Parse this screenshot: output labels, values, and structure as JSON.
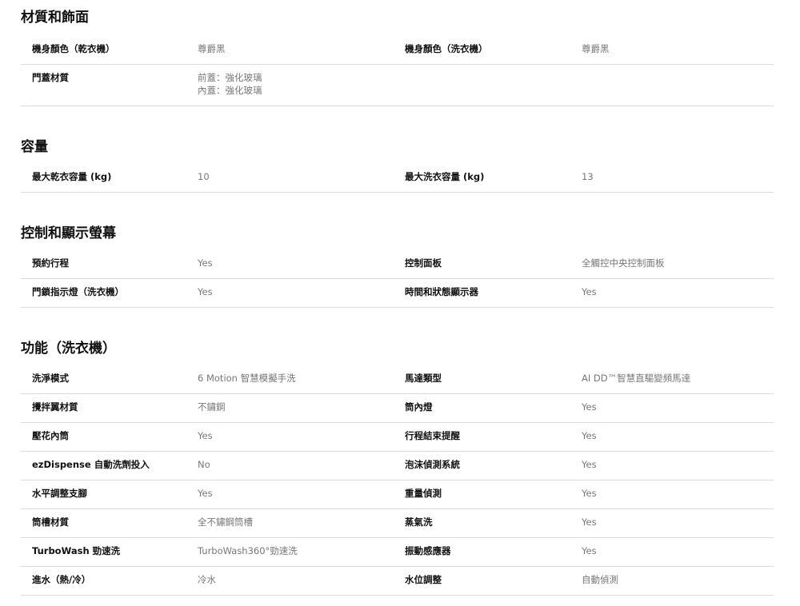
{
  "sections": [
    {
      "title": "材質和飾面",
      "rows": [
        {
          "label1": "機身顏色（乾衣機）",
          "value1": "尊爵黑",
          "label2": "機身顏色（洗衣機）",
          "value2": "尊爵黑"
        },
        {
          "label1": "門蓋材質",
          "value1_lines": [
            "前蓋：強化玻璃",
            "內蓋：強化玻璃"
          ],
          "label2": "",
          "value2": ""
        }
      ]
    },
    {
      "title": "容量",
      "rows": [
        {
          "label1": "最大乾衣容量 (kg)",
          "value1": "10",
          "label2": "最大洗衣容量 (kg)",
          "value2": "13"
        }
      ]
    },
    {
      "title": "控制和顯示螢幕",
      "rows": [
        {
          "label1": "預約行程",
          "value1": "Yes",
          "label2": "控制面板",
          "value2": "全觸控中央控制面板"
        },
        {
          "label1": "門鎖指示燈（洗衣機）",
          "value1": "Yes",
          "label2": "時間和狀態顯示器",
          "value2": "Yes"
        }
      ]
    },
    {
      "title": "功能（洗衣機）",
      "rows": [
        {
          "label1": "洗淨模式",
          "value1": "6 Motion 智慧模擬手洗",
          "label2": "馬達類型",
          "value2": "AI DD™智慧直驅變頻馬達"
        },
        {
          "label1": "攪拌翼材質",
          "value1": "不鏽鋼",
          "label2": "筒內燈",
          "value2": "Yes"
        },
        {
          "label1": "壓花內筒",
          "value1": "Yes",
          "label2": "行程結束提醒",
          "value2": "Yes"
        },
        {
          "label1": "ezDispense 自動洗劑投入",
          "value1": "No",
          "label2": "泡沫偵測系統",
          "value2": "Yes"
        },
        {
          "label1": "水平調整支腳",
          "value1": "Yes",
          "label2": "重量偵測",
          "value2": "Yes"
        },
        {
          "label1": "筒槽材質",
          "value1": "全不鏽鋼筒槽",
          "label2": "蒸氣洗",
          "value2": "Yes"
        },
        {
          "label1": "TurboWash 勁速洗",
          "value1": "TurboWash360°勁速洗",
          "label2": "振動感應器",
          "value2": "Yes"
        },
        {
          "label1": "進水（熱/冷）",
          "value1": "冷水",
          "label2": "水位調整",
          "value2": "自動偵測"
        }
      ]
    }
  ]
}
